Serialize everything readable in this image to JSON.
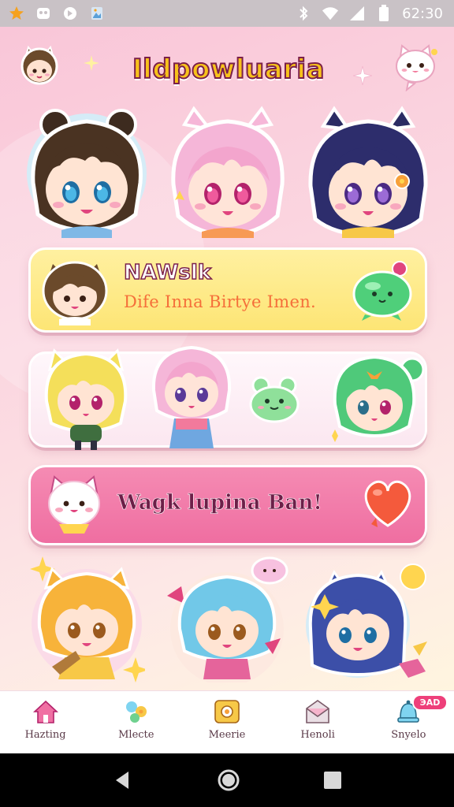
{
  "status_bar": {
    "time": "62:30",
    "left_icons": [
      "notification-star-icon",
      "app-notification-icon",
      "sync-icon",
      "gallery-icon"
    ],
    "right_icons": [
      "bluetooth-icon",
      "wifi-icon",
      "signal-icon",
      "battery-icon"
    ]
  },
  "header": {
    "title": "Ildpowluaria"
  },
  "cards": {
    "yellow": {
      "title": "NAWslk",
      "subtitle": "Dife Inna Birtye Imen."
    },
    "pink": {
      "text": "Wagk lupina Ban!"
    }
  },
  "bottom_nav": {
    "items": [
      {
        "label": "Hazting",
        "icon": "home-icon"
      },
      {
        "label": "Mlecte",
        "icon": "flower-icon"
      },
      {
        "label": "Meerie",
        "icon": "camera-icon"
      },
      {
        "label": "Henoli",
        "icon": "mail-icon"
      },
      {
        "label": "Snyelo",
        "icon": "bell-icon"
      }
    ],
    "badge": "ЭAD"
  },
  "colors": {
    "accent_pink": "#ef6ea1",
    "accent_yellow": "#fde575",
    "title_yellow": "#f7c21b",
    "nav_active": "#e0457e"
  }
}
